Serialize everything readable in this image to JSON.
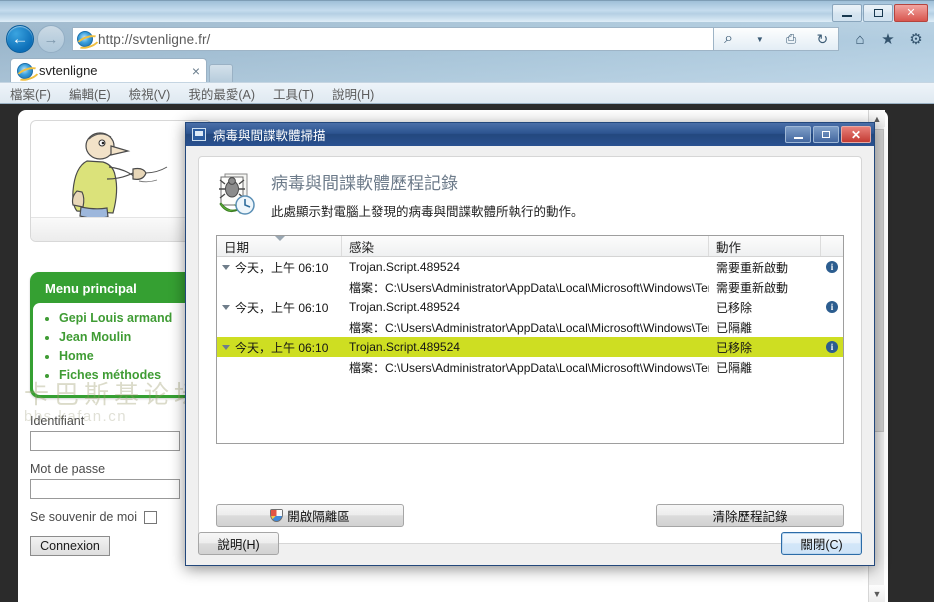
{
  "browser": {
    "window_controls": {
      "minimize": "minimize-icon",
      "maximize": "maximize-icon",
      "close": "close-icon"
    },
    "back_label": "←",
    "forward_label": "→",
    "address_url": "http://svtenligne.fr/",
    "address_tools": [
      "search-icon",
      "chevron-down-icon",
      "compat-view-icon",
      "refresh-icon"
    ],
    "toolbar_icons": [
      "home-icon",
      "favorites-star-icon",
      "tools-gear-icon"
    ],
    "tab_label": "svtenligne",
    "tab_close": "×",
    "menu_items": [
      {
        "label": "檔案(F)"
      },
      {
        "label": "編輯(E)"
      },
      {
        "label": "檢視(V)"
      },
      {
        "label": "我的最愛(A)"
      },
      {
        "label": "工具(T)"
      },
      {
        "label": "說明(H)"
      }
    ]
  },
  "page": {
    "menu_card": {
      "title": "Menu principal",
      "links": [
        {
          "label": "Gepi Louis armand"
        },
        {
          "label": "Jean Moulin"
        },
        {
          "label": "Home"
        },
        {
          "label": "Fiches méthodes"
        }
      ]
    },
    "login": {
      "identifiant_label": "Identifiant",
      "identifiant_value": "",
      "password_label": "Mot de passe",
      "password_value": "",
      "remember_label": "Se souvenir de moi",
      "submit_label": "Connexion"
    },
    "watermark": {
      "cn": "卡巴斯基论坛",
      "url": "bbs.kafan.cn"
    }
  },
  "dialog": {
    "titlebar": {
      "title": "病毒與間諜軟體掃描",
      "minimize": "minimize-icon",
      "maximize": "maximize-icon",
      "close": "✕"
    },
    "header": {
      "title": "病毒與間諜軟體歷程記錄",
      "subtitle": "此處顯示對電腦上發現的病毒與間諜軟體所執行的動作。"
    },
    "table": {
      "columns": [
        "日期",
        "感染",
        "動作",
        ""
      ],
      "sort_column": "日期",
      "rows": [
        {
          "date": "今天，上午 06:10",
          "infection": "Trojan.Script.489524",
          "action": "需要重新啟動",
          "info": "i",
          "kind": "parent",
          "selected": false
        },
        {
          "date": "",
          "infection": "檔案：C:\\Users\\Administrator\\AppData\\Local\\Microsoft\\Windows\\Tempor…",
          "action": "需要重新啟動",
          "info": "",
          "kind": "child",
          "selected": false
        },
        {
          "date": "今天，上午 06:10",
          "infection": "Trojan.Script.489524",
          "action": "已移除",
          "info": "i",
          "kind": "parent",
          "selected": false
        },
        {
          "date": "",
          "infection": "檔案：C:\\Users\\Administrator\\AppData\\Local\\Microsoft\\Windows\\Tempor…",
          "action": "已隔離",
          "info": "",
          "kind": "child",
          "selected": false
        },
        {
          "date": "今天，上午 06:10",
          "infection": "Trojan.Script.489524",
          "action": "已移除",
          "info": "i",
          "kind": "parent",
          "selected": true
        },
        {
          "date": "",
          "infection": "檔案：C:\\Users\\Administrator\\AppData\\Local\\Microsoft\\Windows\\Tempor…",
          "action": "已隔離",
          "info": "",
          "kind": "child",
          "selected": false
        }
      ],
      "selection_color": "#cede22"
    },
    "buttons": {
      "open_quarantine": "開啟隔離區",
      "clear_history": "清除歷程記錄",
      "help": "說明(H)",
      "close": "關閉(C)"
    }
  }
}
